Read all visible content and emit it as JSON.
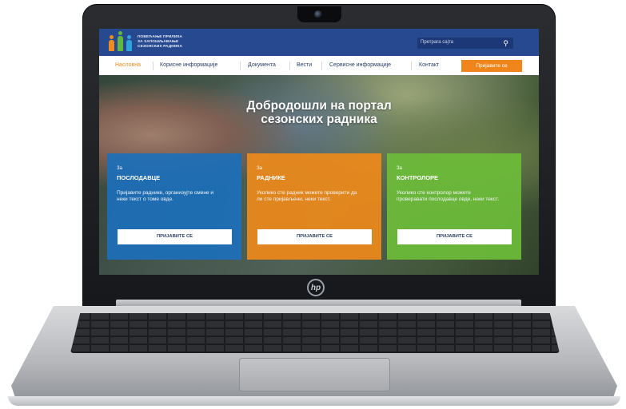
{
  "site": {
    "logo_text": [
      "ПОВЕЋАЊЕ ПРИЛИКА",
      "ЗА ЗАПОШЉАВАЊЕ",
      "СЕЗОНСКИХ РАДНИКА"
    ],
    "search_placeholder": "Претрага сајта",
    "nav": {
      "items": [
        "Насловна",
        "Корисне информације",
        "Документа",
        "Вести",
        "Сервисне информације",
        "Контакт"
      ],
      "active": "Насловна",
      "cta": "Пријавите се"
    },
    "hero_title": [
      "Добродошли на портал",
      "сезонских радника"
    ],
    "cards": [
      {
        "pre": "За",
        "title": "ПОСЛОДАВЦЕ",
        "text": "Пријавите раднике, организујте смене и неки текст о томе овде.",
        "button": "ПРИЈАВИТЕ СЕ",
        "color": "#1c6fba"
      },
      {
        "pre": "За",
        "title": "РАДНИКЕ",
        "text": "Уколико сте радник можете проверити да ли сте пријављени, неки текст.",
        "button": "ПРИЈАВИТЕ СЕ",
        "color": "#ee8a1a"
      },
      {
        "pre": "За",
        "title": "КОНТРОЛОРЕ",
        "text": "Уколико сте контролор можете проверавати послодавце овде, неки текст.",
        "button": "ПРИЈАВИТЕ СЕ",
        "color": "#6cbd3a"
      }
    ]
  },
  "laptop": {
    "brand_logo": "hp"
  },
  "colors": {
    "header": "#27498f",
    "accent": "#f0861b"
  }
}
